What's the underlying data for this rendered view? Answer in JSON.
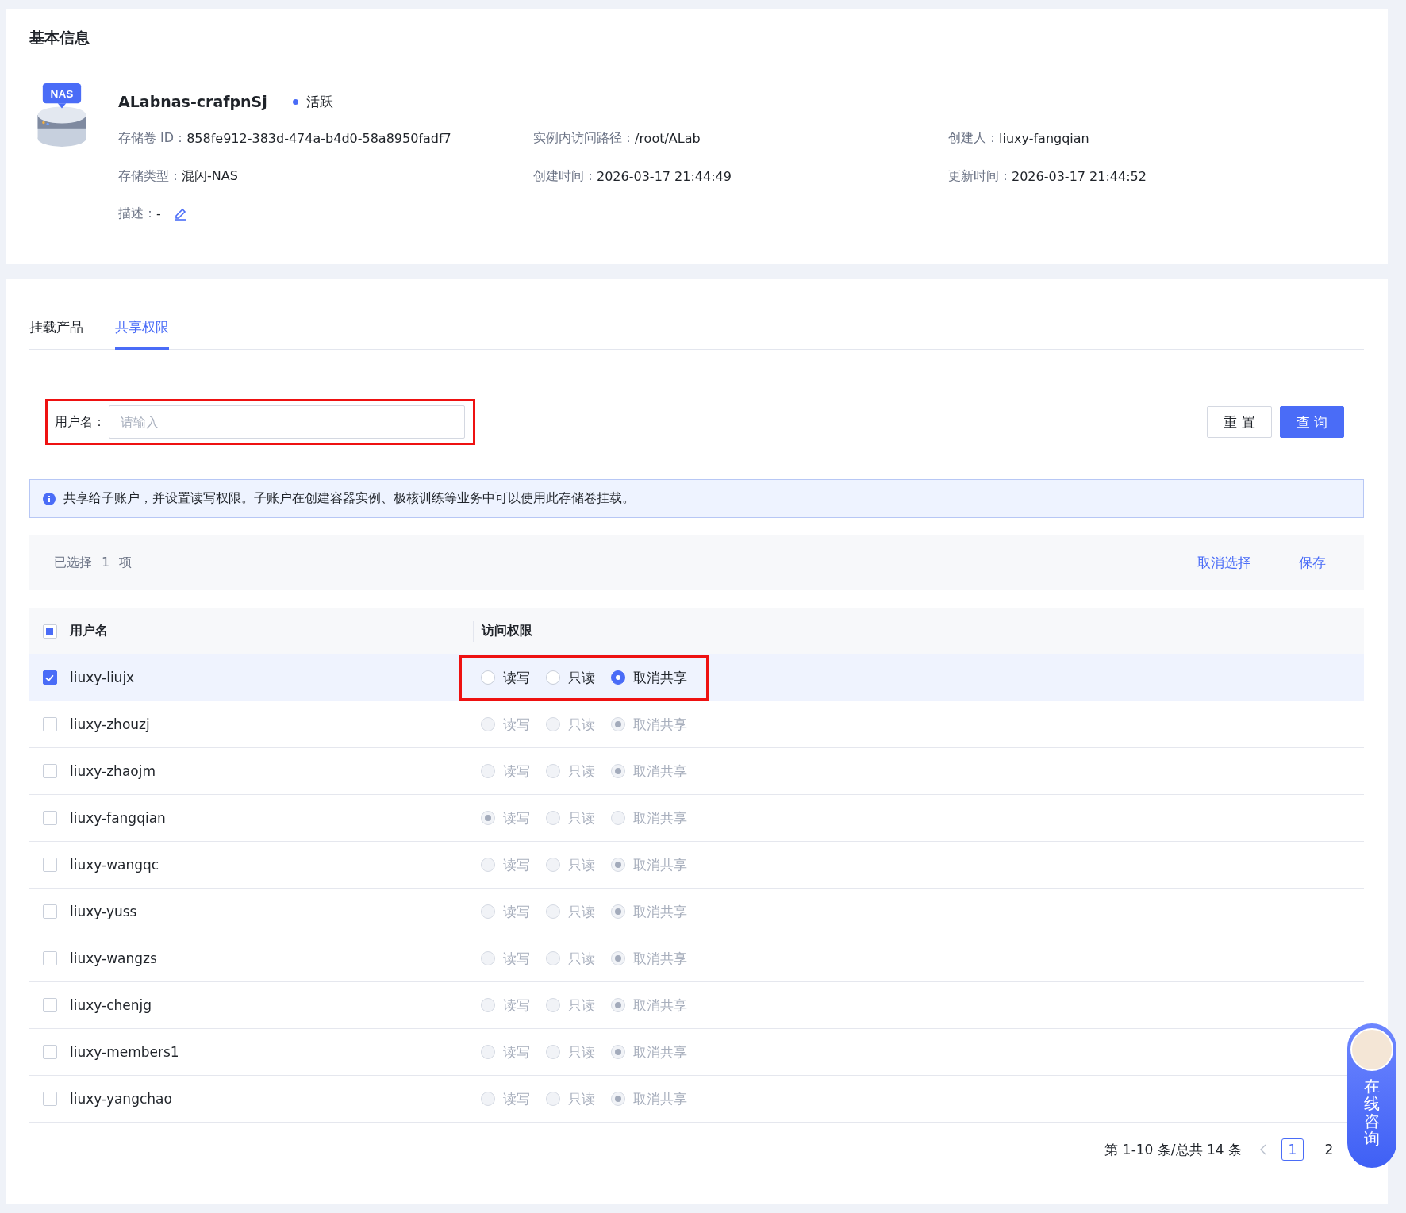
{
  "basic_info": {
    "title": "基本信息",
    "icon_badge": "NAS",
    "name": "ALabnas-crafpnSj",
    "status": {
      "label": "活跃",
      "color": "#4a6cf7"
    },
    "fields": [
      {
        "label": "存储卷 ID：",
        "value": "858fe912-383d-474a-b4d0-58a8950fadf7"
      },
      {
        "label": "实例内访问路径：",
        "value": "/root/ALab"
      },
      {
        "label": "创建人：",
        "value": "liuxy-fangqian"
      },
      {
        "label": "存储类型：",
        "value": "混闪-NAS"
      },
      {
        "label": "创建时间：",
        "value": "2026-03-17 21:44:49"
      },
      {
        "label": "更新时间：",
        "value": "2026-03-17 21:44:52"
      }
    ],
    "description": {
      "label": "描述：",
      "value": "-"
    }
  },
  "tabs": [
    {
      "label": "挂载产品",
      "selected": false
    },
    {
      "label": "共享权限",
      "selected": true
    }
  ],
  "filter": {
    "label": "用户名：",
    "placeholder": "请输入",
    "highlighted": true
  },
  "buttons": [
    {
      "label": "重 置",
      "kind": "default"
    },
    {
      "label": "查 询",
      "kind": "primary"
    }
  ],
  "notice": "共享给子账户，并设置读写权限。子账户在创建容器实例、极核训练等业务中可以使用此存储卷挂载。",
  "selection_bar": {
    "prefix": "已选择",
    "count": "1",
    "suffix": "项",
    "actions": [
      "取消选择",
      "保存"
    ]
  },
  "table": {
    "columns": [
      "用户名",
      "访问权限"
    ],
    "some_selected": true,
    "rows": [
      {
        "name": "liuxy-liujx",
        "selected": true,
        "disabled": false,
        "highlighted": true,
        "access": [
          {
            "label": "读写",
            "selected": false
          },
          {
            "label": "只读",
            "selected": false
          },
          {
            "label": "取消共享",
            "selected": true
          }
        ]
      },
      {
        "name": "liuxy-zhouzj",
        "selected": false,
        "disabled": true,
        "highlighted": false,
        "access": [
          {
            "label": "读写",
            "selected": false
          },
          {
            "label": "只读",
            "selected": false
          },
          {
            "label": "取消共享",
            "selected": true
          }
        ]
      },
      {
        "name": "liuxy-zhaojm",
        "selected": false,
        "disabled": true,
        "highlighted": false,
        "access": [
          {
            "label": "读写",
            "selected": false
          },
          {
            "label": "只读",
            "selected": false
          },
          {
            "label": "取消共享",
            "selected": true
          }
        ]
      },
      {
        "name": "liuxy-fangqian",
        "selected": false,
        "disabled": true,
        "highlighted": false,
        "access": [
          {
            "label": "读写",
            "selected": true
          },
          {
            "label": "只读",
            "selected": false
          },
          {
            "label": "取消共享",
            "selected": false
          }
        ]
      },
      {
        "name": "liuxy-wangqc",
        "selected": false,
        "disabled": true,
        "highlighted": false,
        "access": [
          {
            "label": "读写",
            "selected": false
          },
          {
            "label": "只读",
            "selected": false
          },
          {
            "label": "取消共享",
            "selected": true
          }
        ]
      },
      {
        "name": "liuxy-yuss",
        "selected": false,
        "disabled": true,
        "highlighted": false,
        "access": [
          {
            "label": "读写",
            "selected": false
          },
          {
            "label": "只读",
            "selected": false
          },
          {
            "label": "取消共享",
            "selected": true
          }
        ]
      },
      {
        "name": "liuxy-wangzs",
        "selected": false,
        "disabled": true,
        "highlighted": false,
        "access": [
          {
            "label": "读写",
            "selected": false
          },
          {
            "label": "只读",
            "selected": false
          },
          {
            "label": "取消共享",
            "selected": true
          }
        ]
      },
      {
        "name": "liuxy-chenjg",
        "selected": false,
        "disabled": true,
        "highlighted": false,
        "access": [
          {
            "label": "读写",
            "selected": false
          },
          {
            "label": "只读",
            "selected": false
          },
          {
            "label": "取消共享",
            "selected": true
          }
        ]
      },
      {
        "name": "liuxy-members1",
        "selected": false,
        "disabled": true,
        "highlighted": false,
        "access": [
          {
            "label": "读写",
            "selected": false
          },
          {
            "label": "只读",
            "selected": false
          },
          {
            "label": "取消共享",
            "selected": true
          }
        ]
      },
      {
        "name": "liuxy-yangchao",
        "selected": false,
        "disabled": true,
        "highlighted": false,
        "access": [
          {
            "label": "读写",
            "selected": false
          },
          {
            "label": "只读",
            "selected": false
          },
          {
            "label": "取消共享",
            "selected": true
          }
        ]
      }
    ]
  },
  "pagination": {
    "summary": "第 1-10 条/总共 14 条",
    "pages": [
      {
        "label": "1",
        "selected": true
      },
      {
        "label": "2",
        "selected": false
      }
    ]
  },
  "chat_widget": {
    "label": "在线咨询"
  }
}
